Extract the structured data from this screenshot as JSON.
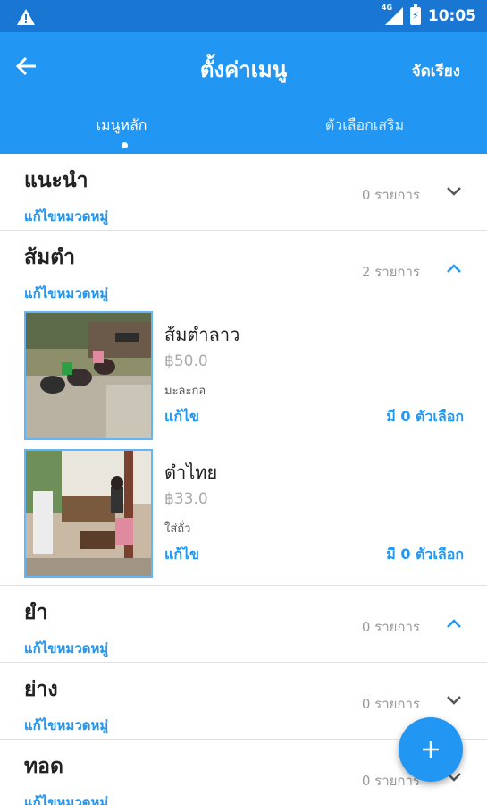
{
  "status_bar": {
    "time": "10:05",
    "network": "4G",
    "icons": [
      "warning-icon",
      "signal-icon",
      "battery-charging-icon"
    ]
  },
  "app_bar": {
    "title": "ตั้งค่าเมนู",
    "back_icon": "arrow-left-icon",
    "reorder_label": "จัดเรียง"
  },
  "tabs": [
    {
      "label": "เมนูหลัก",
      "selected": true
    },
    {
      "label": "ตัวเลือกเสริม",
      "selected": false
    }
  ],
  "categories": [
    {
      "name": "แนะนำ",
      "edit_label": "แก้ไขหมวดหมู่",
      "count": "0 รายการ",
      "expanded": false,
      "items": []
    },
    {
      "name": "ส้มตำ",
      "edit_label": "แก้ไขหมวดหมู่",
      "count": "2 รายการ",
      "expanded": true,
      "items": [
        {
          "name": "ส้มตำลาว",
          "price": "฿50.0",
          "description": "มะละกอ",
          "edit_label": "แก้ไข",
          "options_label": "มี 0 ตัวเลือก",
          "image": "street-motorbikes-photo"
        },
        {
          "name": "ตำไทย",
          "price": "฿33.0",
          "description": "ใส่ถั่ว",
          "edit_label": "แก้ไข",
          "options_label": "มี 0 ตัวเลือก",
          "image": "restaurant-interior-photo"
        }
      ]
    },
    {
      "name": "ยำ",
      "edit_label": "แก้ไขหมวดหมู่",
      "count": "0 รายการ",
      "expanded": true,
      "items": []
    },
    {
      "name": "ย่าง",
      "edit_label": "แก้ไขหมวดหมู่",
      "count": "0 รายการ",
      "expanded": false,
      "items": []
    },
    {
      "name": "ทอด",
      "edit_label": "แก้ไขหมวดหมู่",
      "count": "0 รายการ",
      "expanded": false,
      "items": []
    }
  ],
  "fab": {
    "icon": "plus-icon"
  },
  "colors": {
    "status_bar": "#1976d2",
    "app_bar": "#2196f3",
    "accent": "#2196f3",
    "count_text": "#9a9a9a"
  }
}
